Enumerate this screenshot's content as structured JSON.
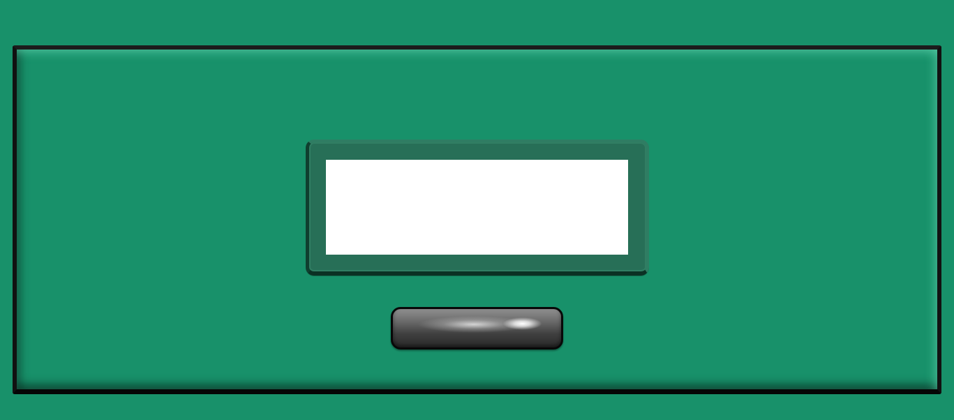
{
  "scene": {
    "background_color": "#18916a",
    "drawer_color": "#18916a",
    "label_holder_color": "#276f57",
    "label_card_color": "#ffffff",
    "label_card_text": "",
    "handle_color": "#4a4a4a",
    "outline_color": "#111111"
  }
}
